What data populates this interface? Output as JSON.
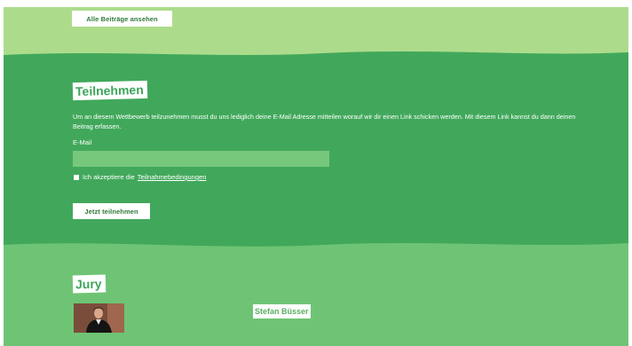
{
  "header": {
    "all_posts_label": "Alle Beiträge ansehen"
  },
  "participate": {
    "title": "Teilnehmen",
    "intro": "Um an diesem Wettbewerb teilzunehmen musst du uns lediglich deine E-Mail Adresse mitteilen worauf wir dir einen Link schicken werden. Mit diesem Link kannst du dann deinen Beitrag erfassen.",
    "email_label": "E-Mail",
    "email_value": "",
    "terms_prefix": "Ich akzeptiere die",
    "terms_link": "Teilnahmebedingungen",
    "submit_label": "Jetzt teilnehmen"
  },
  "jury": {
    "title": "Jury",
    "members": [
      {
        "name": "Stefan Büsser"
      }
    ]
  },
  "colors": {
    "top_band": "#acdc8b",
    "main_band": "#41a85b",
    "jury_band": "#6ec474",
    "input_bg": "#77c77d"
  }
}
